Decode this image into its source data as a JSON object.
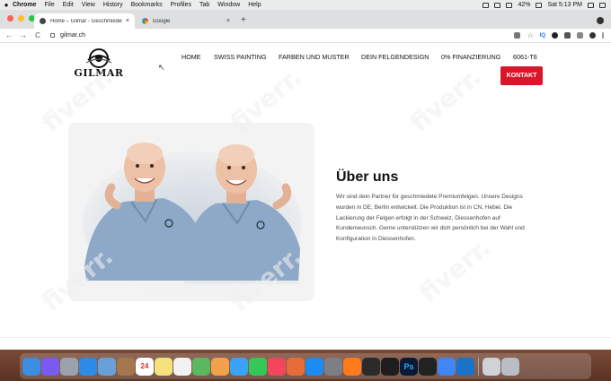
{
  "menubar": {
    "apple": "",
    "items": [
      "Chrome",
      "File",
      "Edit",
      "View",
      "History",
      "Bookmarks",
      "Profiles",
      "Tab",
      "Window",
      "Help"
    ],
    "battery": "42%",
    "clock": "Sat 5:13 PM"
  },
  "tabs": [
    {
      "title": "Home – Gilmar - Geschmiedete Pr",
      "close": "×"
    },
    {
      "title": "Google",
      "close": "×"
    }
  ],
  "new_tab": "+",
  "toolbar": {
    "back": "←",
    "forward": "→",
    "reload": "C",
    "url": "gilmar.ch",
    "iq": "IQ",
    "star": "☆"
  },
  "site": {
    "logo_text": "GILMAR",
    "nav": {
      "home": "HOME",
      "swiss": "SWISS PAINTING",
      "farben": "FARBEN UND MUSTER",
      "felgen": "DEIN FELGENDESIGN",
      "finanzierung": "0% FINANZIERUNG",
      "code": "6061-T6"
    },
    "kontakt": "KONTAKT",
    "portrait_logo": "GILMAR",
    "about_title": "Über uns",
    "about_text": "Wir sind dein Partner für geschmiedete Premiumfelgen. Unsere Designs wurden in DE, Berlin entwickelt. Die Produktion ist in CN, Hebei. Die Lackierung der Felgen erfolgt in der Schweiz, Diessenhofen auf Kundenwunsch. Gerne unterstützen wir dich persönlich bei der Wahl und Konfiguration in Diessenhofen."
  },
  "dock": {
    "calendar_day": "24",
    "ps": "Ps"
  },
  "watermark": "fiverr.",
  "colors": {
    "accent_red": "#d8182a",
    "shirt_blue": "#8ea9c7"
  }
}
